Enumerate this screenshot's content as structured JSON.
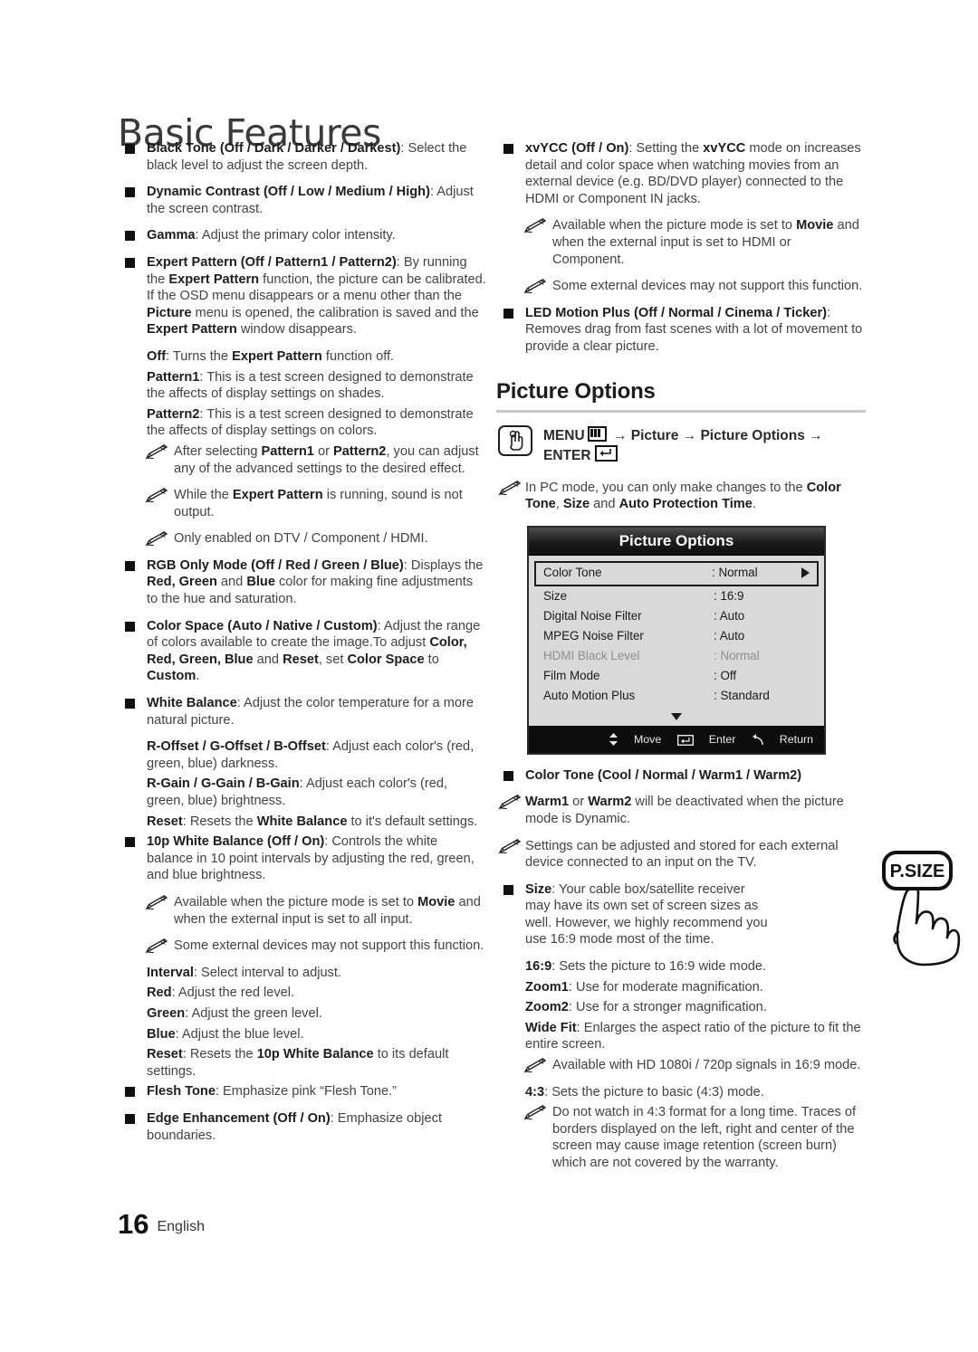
{
  "page_title": "Basic Features",
  "footer": {
    "page_number": "16",
    "language": "English"
  },
  "icons": {
    "bullet": "square-bullet",
    "note": "pencil-note-icon",
    "menu": "menu-icon",
    "enter": "enter-icon",
    "hand": "hand-press-icon",
    "move": "up-down-arrow-icon",
    "return": "return-arrow-icon",
    "right_arrow": "right-triangle-icon",
    "down_arrow": "down-triangle-icon"
  },
  "left_column": [
    {
      "type": "bullet",
      "html": "<b>Black Tone (Off / Dark / Darker / Darkest)</b>: Select the black level to adjust the screen depth."
    },
    {
      "type": "bullet",
      "html": "<b>Dynamic Contrast (Off / Low / Medium / High)</b>: Adjust the screen contrast."
    },
    {
      "type": "bullet",
      "html": "<b>Gamma</b>: Adjust the primary color intensity."
    },
    {
      "type": "bullet",
      "html": "<b>Expert Pattern (Off / Pattern1 / Pattern2)</b>: By running the <b>Expert Pattern</b> function, the picture can be calibrated. If the OSD menu disappears or a menu other than the <b>Picture</b> menu is opened, the calibration is saved and the <b>Expert Pattern</b> window disappears."
    },
    {
      "type": "plain",
      "html": "<b>Off</b>: Turns the <b>Expert Pattern</b> function off."
    },
    {
      "type": "plain",
      "html": "<b>Pattern1</b>: This is a test screen designed to demonstrate the affects of display settings on shades."
    },
    {
      "type": "plain",
      "html": "<b>Pattern2</b>: This is a test screen designed to demonstrate the affects of display settings on colors."
    },
    {
      "type": "note",
      "html": "After selecting <b>Pattern1</b> or <b>Pattern2</b>, you can adjust any of the advanced settings to the desired effect."
    },
    {
      "type": "note",
      "html": "While the <b>Expert Pattern</b> is running, sound is not output."
    },
    {
      "type": "note",
      "html": "Only enabled on DTV / Component / HDMI."
    },
    {
      "type": "bullet",
      "html": "<b>RGB Only Mode (Off / Red / Green / Blue)</b>: Displays the <b>Red, Green</b> and <b>Blue</b> color for making fine adjustments to the hue and saturation."
    },
    {
      "type": "bullet",
      "html": "<b>Color Space (Auto / Native / Custom)</b>: Adjust the range of colors available to create the image.To adjust <b>Color, Red, Green, Blue</b> and <b>Reset</b>, set <b>Color Space</b> to <b>Custom</b>."
    },
    {
      "type": "bullet",
      "html": "<b>White Balance</b>: Adjust the color temperature for a more natural picture."
    },
    {
      "type": "plain",
      "html": "<b>R-Offset / G-Offset / B-Offset</b>: Adjust each color's (red, green, blue) darkness."
    },
    {
      "type": "plain",
      "html": "<b>R-Gain / G-Gain / B-Gain</b>: Adjust each color's (red, green, blue) brightness."
    },
    {
      "type": "plain",
      "html": "<b>Reset</b>: Resets the <b>White Balance</b> to it's default settings."
    },
    {
      "type": "bullet",
      "html": "<b>10p White Balance (Off / On)</b>: Controls the white balance in 10 point intervals by adjusting the red, green, and blue brightness."
    },
    {
      "type": "note",
      "html": "Available when the picture mode is set to <b>Movie</b> and when the external input is set to all input."
    },
    {
      "type": "note",
      "html": "Some external devices may not support this function."
    },
    {
      "type": "plain",
      "html": "<b>Interval</b>: Select interval to adjust."
    },
    {
      "type": "plain",
      "html": "<b>Red</b>: Adjust the red level."
    },
    {
      "type": "plain",
      "html": "<b>Green</b>: Adjust the green level."
    },
    {
      "type": "plain",
      "html": "<b>Blue</b>: Adjust the blue level."
    },
    {
      "type": "plain",
      "html": "<b>Reset</b>: Resets the <b>10p White Balance</b> to its default settings."
    },
    {
      "type": "bullet",
      "html": "<b>Flesh Tone</b>: Emphasize pink &ldquo;Flesh Tone.&rdquo;"
    },
    {
      "type": "bullet",
      "html": "<b>Edge Enhancement (Off / On)</b>: Emphasize object boundaries."
    }
  ],
  "right_column_top": [
    {
      "type": "bullet",
      "html": "<b>xvYCC (Off / On)</b>: Setting the <b>xvYCC</b> mode on increases detail and color space when watching movies from an external device (e.g. BD/DVD player) connected to the HDMI or Component IN jacks."
    },
    {
      "type": "note",
      "html": "Available when the picture mode is set to <b>Movie</b> and when the external input is set to HDMI or Component."
    },
    {
      "type": "note",
      "html": "Some external devices may not support this function."
    },
    {
      "type": "bullet",
      "html": "<b>LED Motion Plus (Off / Normal / Cinema / Ticker)</b>: Removes drag from fast scenes with a lot of movement to provide a clear picture."
    }
  ],
  "section": {
    "heading": "Picture Options",
    "path": {
      "menu_label": "MENU",
      "arrow": "→",
      "step1": "Picture",
      "step2": "Picture Options",
      "enter_label": "ENTER"
    },
    "pc_note": "In PC mode, you can only make changes to the <b>Color Tone</b>, <b>Size</b> and <b>Auto Protection Time</b>."
  },
  "osd": {
    "title": "Picture Options",
    "rows": [
      {
        "label": "Color Tone",
        "value": ": Normal",
        "selected": true,
        "dim": false,
        "arrow": true
      },
      {
        "label": "Size",
        "value": ": 16:9",
        "selected": false,
        "dim": false,
        "arrow": false
      },
      {
        "label": "Digital Noise Filter",
        "value": ": Auto",
        "selected": false,
        "dim": false,
        "arrow": false
      },
      {
        "label": "MPEG Noise Filter",
        "value": ": Auto",
        "selected": false,
        "dim": false,
        "arrow": false
      },
      {
        "label": "HDMI Black Level",
        "value": ": Normal",
        "selected": false,
        "dim": true,
        "arrow": false
      },
      {
        "label": "Film Mode",
        "value": ": Off",
        "selected": false,
        "dim": false,
        "arrow": false
      },
      {
        "label": "Auto Motion Plus",
        "value": ": Standard",
        "selected": false,
        "dim": false,
        "arrow": false
      }
    ],
    "footer": {
      "move": "Move",
      "enter": "Enter",
      "return": "Return"
    }
  },
  "right_column_bottom": [
    {
      "type": "bullet",
      "html": "<b>Color Tone (Cool / Normal / Warm1 / Warm2)</b>"
    },
    {
      "type": "note0",
      "html": "<b>Warm1</b> or <b>Warm2</b> will be deactivated when the picture mode is Dynamic."
    },
    {
      "type": "note0",
      "html": "Settings can be adjusted and stored for each external device connected to an input on the TV."
    },
    {
      "type": "bullet_narrow",
      "html": "<b>Size</b>: Your cable box/satellite receiver may have its own set of screen sizes as well. However, we highly recommend you use 16:9 mode most of the time."
    },
    {
      "type": "plain_narrow",
      "html": "<b>16:9</b>: Sets the picture to 16:9 wide mode."
    },
    {
      "type": "plain_narrow",
      "html": "<b>Zoom1</b>: Use for moderate magnification."
    },
    {
      "type": "plain",
      "html": "<b>Zoom2</b>: Use for a stronger magnification."
    },
    {
      "type": "plain",
      "html": "<b>Wide Fit</b>: Enlarges the aspect ratio of the picture to fit the entire screen."
    },
    {
      "type": "note",
      "html": "Available with HD 1080i / 720p signals in 16:9 mode."
    },
    {
      "type": "plain",
      "html": "<b>4:3</b>: Sets the picture to basic (4:3) mode."
    },
    {
      "type": "note",
      "html": "Do not watch in 4:3 format for a long time. Traces of borders displayed on the left, right and center of the screen may cause image retention (screen burn) which are not covered by the warranty."
    }
  ],
  "psize_button": {
    "label": "P.SIZE"
  }
}
